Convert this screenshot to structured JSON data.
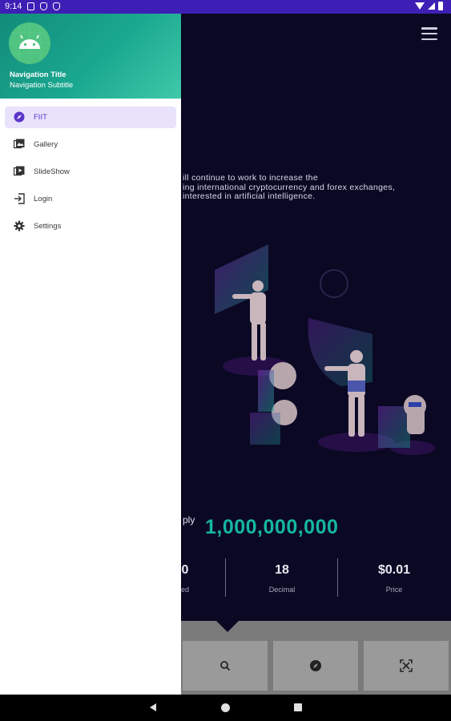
{
  "status_bar": {
    "time": "9:14"
  },
  "main": {
    "intro_lines": [
      "ill continue to work to increase the",
      "ing international cryptocurrency and forex exchanges,",
      "interested in artificial intelligence."
    ],
    "supply_label": "ply",
    "supply_value": "1,000,000,000",
    "stats": [
      {
        "value": "0",
        "label": "ed"
      },
      {
        "value": "18",
        "label": "Decimal"
      },
      {
        "value": "$0.01",
        "label": "Price"
      }
    ]
  },
  "drawer": {
    "title": "Navigation Title",
    "subtitle": "Navigation Subtitle",
    "items": [
      {
        "label": "FIIT",
        "icon": "compass-icon",
        "active": true
      },
      {
        "label": "Gallery",
        "icon": "gallery-icon",
        "active": false
      },
      {
        "label": "SlideShow",
        "icon": "slideshow-icon",
        "active": false
      },
      {
        "label": "Login",
        "icon": "login-icon",
        "active": false
      },
      {
        "label": "Settings",
        "icon": "gear-icon",
        "active": false
      }
    ]
  },
  "colors": {
    "status_bar": "#3d1fb5",
    "accent": "#5b34c9",
    "supply_value": "#15b6a2",
    "drawer_header": "#1aa890"
  }
}
